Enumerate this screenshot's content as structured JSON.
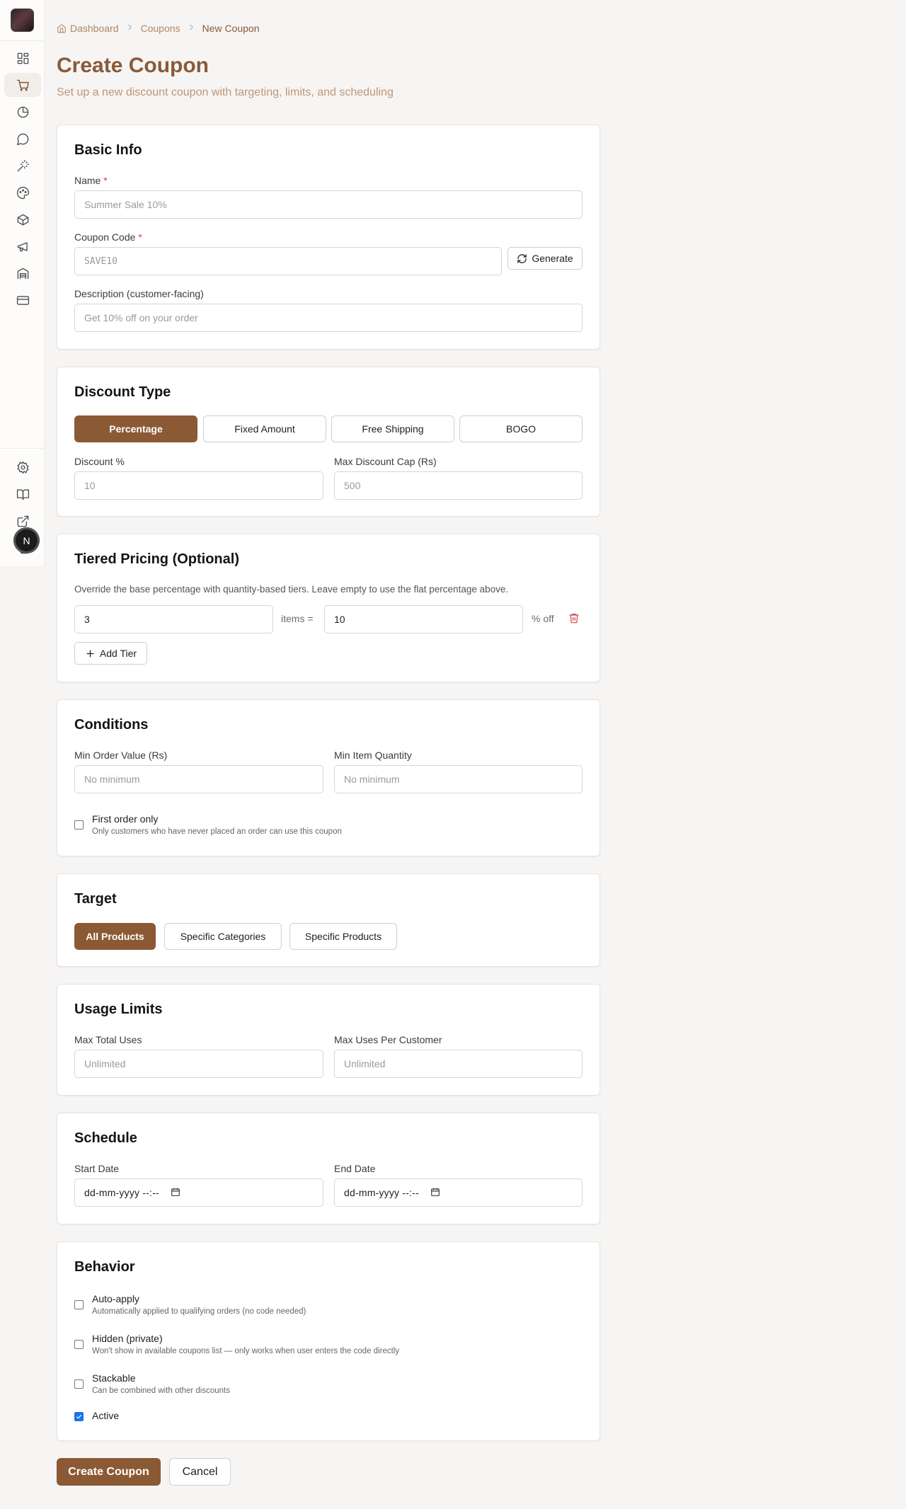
{
  "sidebar": {
    "items": [
      {
        "icon": "dashboard-icon"
      },
      {
        "icon": "cart-icon",
        "active": true
      },
      {
        "icon": "pie-chart-icon"
      },
      {
        "icon": "chat-icon"
      },
      {
        "icon": "magic-wand-icon"
      },
      {
        "icon": "palette-icon"
      },
      {
        "icon": "package-icon"
      },
      {
        "icon": "megaphone-icon"
      },
      {
        "icon": "warehouse-icon"
      },
      {
        "icon": "credit-card-icon"
      }
    ],
    "bottom_items": [
      {
        "icon": "gear-icon"
      },
      {
        "icon": "book-icon"
      },
      {
        "icon": "external-link-icon"
      },
      {
        "icon": "copy-icon"
      }
    ],
    "avatar_letter": "N"
  },
  "breadcrumb": {
    "home": "Dashboard",
    "section": "Coupons",
    "current": "New Coupon"
  },
  "page": {
    "title": "Create Coupon",
    "subtitle": "Set up a new discount coupon with targeting, limits, and scheduling"
  },
  "basic_info": {
    "title": "Basic Info",
    "name_label": "Name",
    "name_placeholder": "Summer Sale 10%",
    "code_label": "Coupon Code",
    "code_placeholder": "SAVE10",
    "generate_label": "Generate",
    "description_label": "Description (customer-facing)",
    "description_placeholder": "Get 10% off on your order",
    "required_mark": "*"
  },
  "discount_type": {
    "title": "Discount Type",
    "options": [
      "Percentage",
      "Fixed Amount",
      "Free Shipping",
      "BOGO"
    ],
    "selected": "Percentage",
    "discount_label": "Discount %",
    "discount_placeholder": "10",
    "cap_label": "Max Discount Cap (Rs)",
    "cap_placeholder": "500"
  },
  "tiered": {
    "title": "Tiered Pricing (Optional)",
    "description": "Override the base percentage with quantity-based tiers. Leave empty to use the flat percentage above.",
    "tier": {
      "items": "3",
      "items_label": "items =",
      "percent": "10",
      "percent_label": "% off"
    },
    "add_label": "Add Tier"
  },
  "conditions": {
    "title": "Conditions",
    "min_order_label": "Min Order Value (Rs)",
    "min_order_placeholder": "No minimum",
    "min_qty_label": "Min Item Quantity",
    "min_qty_placeholder": "No minimum",
    "first_order_label": "First order only",
    "first_order_help": "Only customers who have never placed an order can use this coupon"
  },
  "target": {
    "title": "Target",
    "options": [
      "All Products",
      "Specific Categories",
      "Specific Products"
    ],
    "selected": "All Products"
  },
  "usage": {
    "title": "Usage Limits",
    "max_total_label": "Max Total Uses",
    "max_total_placeholder": "Unlimited",
    "max_per_label": "Max Uses Per Customer",
    "max_per_placeholder": "Unlimited"
  },
  "schedule": {
    "title": "Schedule",
    "start_label": "Start Date",
    "start_value": "dd-mm-yyyy --:--",
    "end_label": "End Date",
    "end_value": "dd-mm-yyyy --:--"
  },
  "behavior": {
    "title": "Behavior",
    "auto_apply_label": "Auto-apply",
    "auto_apply_help": "Automatically applied to qualifying orders (no code needed)",
    "hidden_label": "Hidden (private)",
    "hidden_help": "Won't show in available coupons list — only works when user enters the code directly",
    "stackable_label": "Stackable",
    "stackable_help": "Can be combined with other discounts",
    "active_label": "Active",
    "active_checked": true
  },
  "actions": {
    "create_label": "Create Coupon",
    "cancel_label": "Cancel"
  },
  "colors": {
    "brand": "#8b5a35",
    "checkbox_checked": "#1a73e8",
    "danger": "#d14343"
  }
}
